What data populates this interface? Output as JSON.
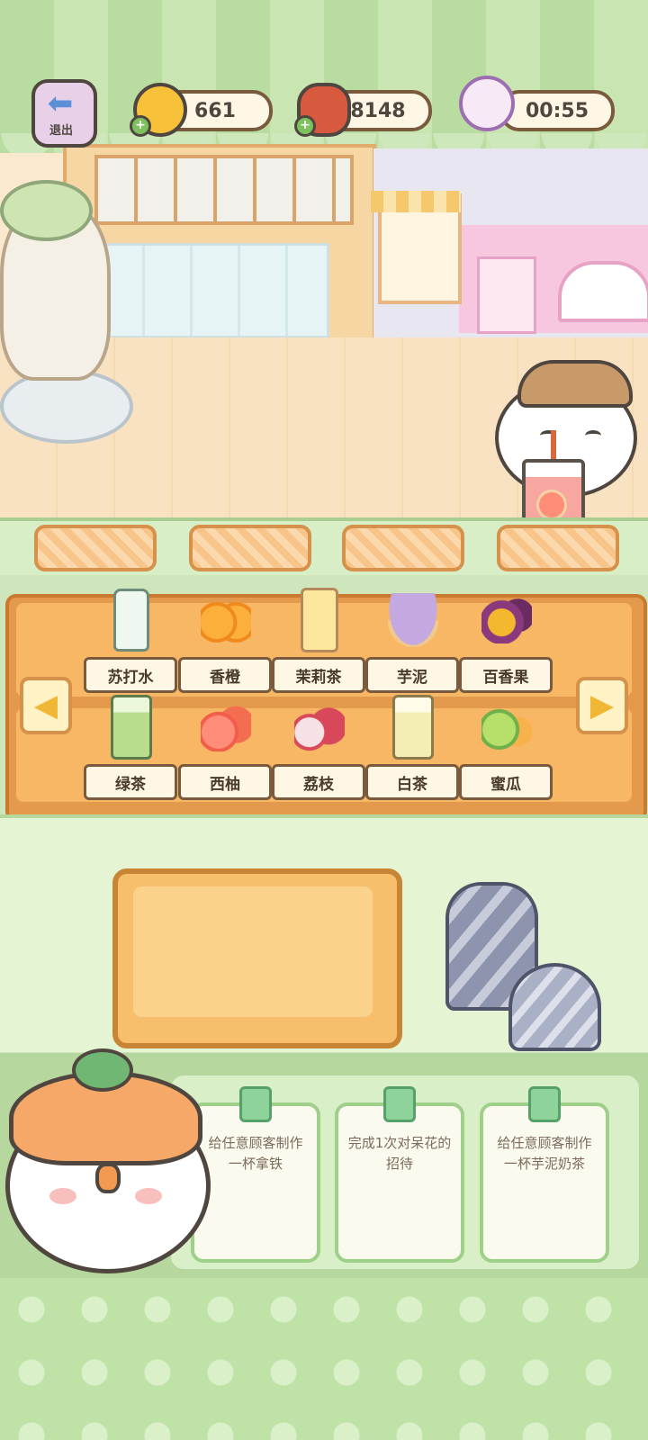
{
  "hud": {
    "exit_label": "退出",
    "coins": "661",
    "meat": "8148",
    "timer": "00:55",
    "plus_glyph": "+"
  },
  "ingredients": {
    "row1": [
      {
        "label": "苏打水",
        "icon": "soda-bottle-icon"
      },
      {
        "label": "香橙",
        "icon": "orange-icon"
      },
      {
        "label": "茉莉茶",
        "icon": "jasmine-tea-icon"
      },
      {
        "label": "芋泥",
        "icon": "taro-paste-icon"
      },
      {
        "label": "百香果",
        "icon": "passion-fruit-icon"
      }
    ],
    "row2": [
      {
        "label": "绿茶",
        "icon": "green-tea-icon"
      },
      {
        "label": "西柚",
        "icon": "grapefruit-icon"
      },
      {
        "label": "荔枝",
        "icon": "lychee-icon"
      },
      {
        "label": "白茶",
        "icon": "white-tea-icon"
      },
      {
        "label": "蜜瓜",
        "icon": "melon-icon"
      }
    ]
  },
  "quests": [
    {
      "text": "给任意顾客制作一杯拿铁"
    },
    {
      "text": "完成1次对呆花的招待"
    },
    {
      "text": "给任意顾客制作一杯芋泥奶茶"
    }
  ],
  "colors": {
    "accent_orange": "#f7b764",
    "panel_green": "#cfe6bd",
    "label_border": "#7a5a3c"
  }
}
